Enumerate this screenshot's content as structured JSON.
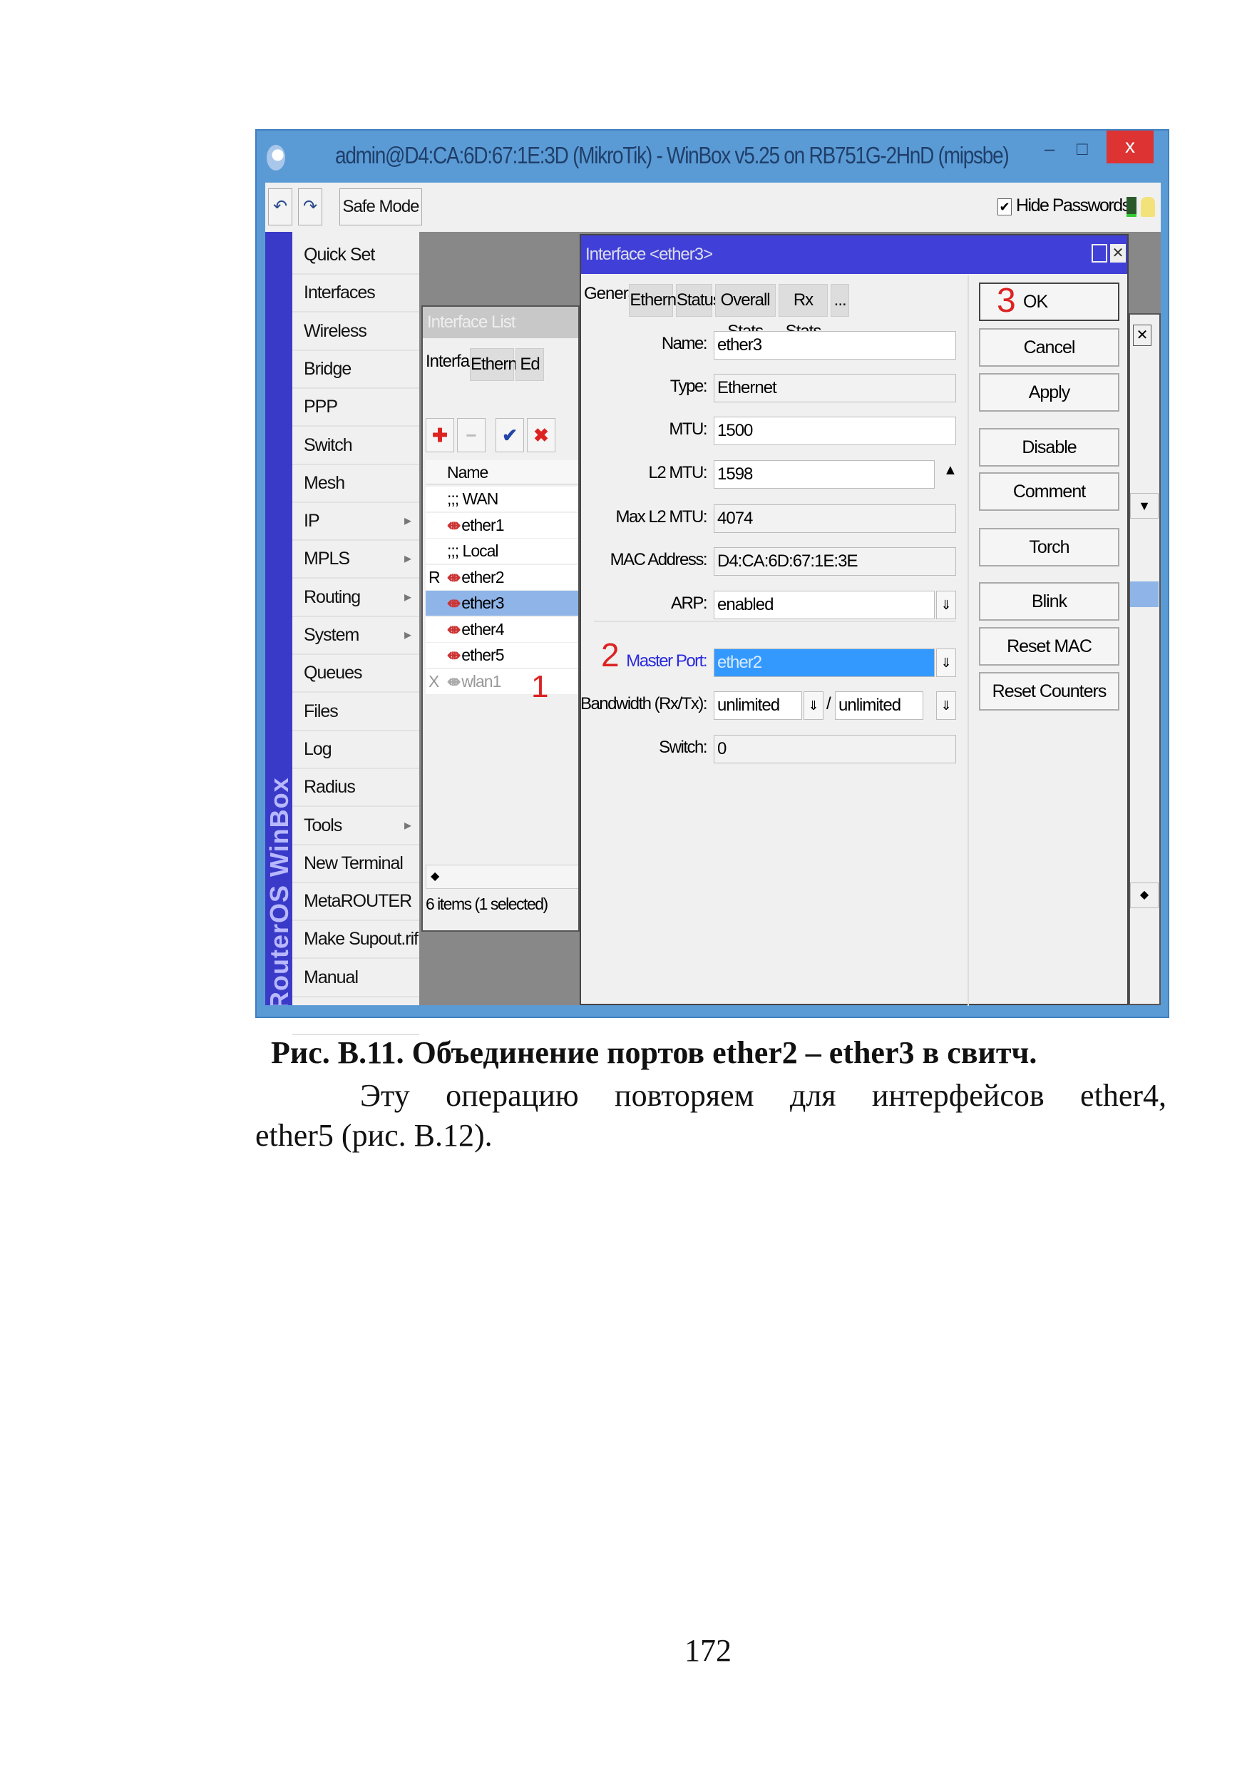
{
  "window": {
    "title": "admin@D4:CA:6D:67:1E:3D (MikroTik) - WinBox v5.25 on RB751G-2HnD (mipsbe)",
    "minimize": "–",
    "maximize": "□",
    "close": "x"
  },
  "toolbar": {
    "undo": "↶",
    "redo": "↷",
    "safe_mode": "Safe Mode",
    "hide_passwords_checked": true,
    "hide_passwords": "Hide Passwords"
  },
  "sidebar": {
    "brand": "RouterOS WinBox",
    "items": [
      {
        "label": "Quick Set"
      },
      {
        "label": "Interfaces"
      },
      {
        "label": "Wireless"
      },
      {
        "label": "Bridge"
      },
      {
        "label": "PPP"
      },
      {
        "label": "Switch"
      },
      {
        "label": "Mesh"
      },
      {
        "label": "IP",
        "submenu": true
      },
      {
        "label": "MPLS",
        "submenu": true
      },
      {
        "label": "Routing",
        "submenu": true
      },
      {
        "label": "System",
        "submenu": true
      },
      {
        "label": "Queues"
      },
      {
        "label": "Files"
      },
      {
        "label": "Log"
      },
      {
        "label": "Radius"
      },
      {
        "label": "Tools",
        "submenu": true
      },
      {
        "label": "New Terminal"
      },
      {
        "label": "MetaROUTER"
      },
      {
        "label": "Make Supout.rif"
      },
      {
        "label": "Manual"
      }
    ]
  },
  "interface_list": {
    "title": "Interface List",
    "tabs": [
      "Interface",
      "Ethernet",
      "Ed"
    ],
    "column": "Name",
    "rows": [
      {
        "flag": "",
        "name": ";;; WAN",
        "comment": true
      },
      {
        "flag": "",
        "name": "ether1"
      },
      {
        "flag": "",
        "name": ";;; Local",
        "comment": true
      },
      {
        "flag": "R",
        "name": "ether2"
      },
      {
        "flag": "",
        "name": "ether3",
        "selected": true
      },
      {
        "flag": "",
        "name": "ether4"
      },
      {
        "flag": "",
        "name": "ether5"
      },
      {
        "flag": "X",
        "name": "wlan1",
        "disabled": true
      }
    ],
    "status": "6 items (1 selected)"
  },
  "dialog": {
    "title": "Interface <ether3>",
    "tabs": [
      "General",
      "Ethernet",
      "Status",
      "Overall Stats",
      "Rx Stats",
      "..."
    ],
    "fields": {
      "name_label": "Name:",
      "name": "ether3",
      "type_label": "Type:",
      "type": "Ethernet",
      "mtu_label": "MTU:",
      "mtu": "1500",
      "l2mtu_label": "L2 MTU:",
      "l2mtu": "1598",
      "max_l2mtu_label": "Max L2 MTU:",
      "max_l2mtu": "4074",
      "mac_label": "MAC Address:",
      "mac": "D4:CA:6D:67:1E:3E",
      "arp_label": "ARP:",
      "arp": "enabled",
      "master_port_label": "Master Port:",
      "master_port": "ether2",
      "bandwidth_label": "Bandwidth (Rx/Tx):",
      "bandwidth_rx": "unlimited",
      "bandwidth_sep": "/",
      "bandwidth_tx": "unlimited",
      "switch_label": "Switch:",
      "switch": "0"
    },
    "buttons": [
      "OK",
      "Cancel",
      "Apply",
      "Disable",
      "Comment",
      "Torch",
      "Blink",
      "Reset MAC Address",
      "Reset Counters"
    ]
  },
  "annotations": {
    "step1": "1",
    "step2": "2",
    "step3": "3"
  },
  "colors": {
    "annotation": "#dd2222",
    "selection": "#3399ff",
    "titlebar": "#5b9bd5",
    "dialog_title": "#4040d8"
  },
  "caption": {
    "figure": "Рис. В.11. Объединение портов ether2 – ether3 в свитч.",
    "line1": "Эту операцию повторяем для интерфейсов ether4,",
    "line2": "ether5 (рис. В.12)."
  },
  "page_number": "172"
}
